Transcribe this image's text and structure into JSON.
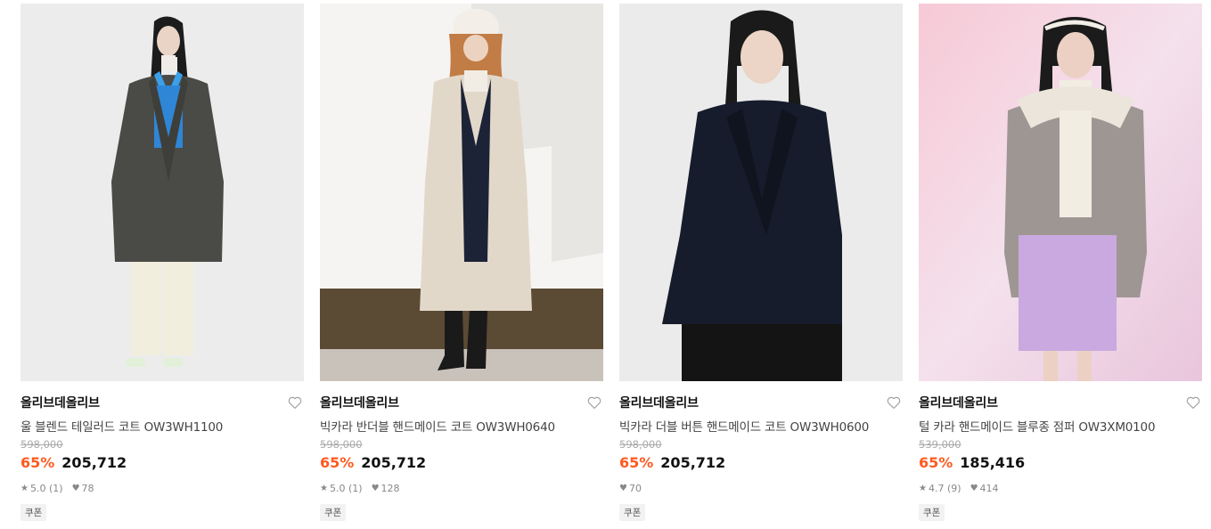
{
  "products": [
    {
      "brand": "올리브데올리브",
      "name": "울 블렌드 테일러드 코트 OW3WH1100",
      "original_price": "598,000",
      "discount": "65%",
      "price": "205,712",
      "rating": "5.0",
      "review_count": "(1)",
      "likes": "78",
      "coupon": "쿠폰"
    },
    {
      "brand": "올리브데올리브",
      "name": "빅카라 반더블 핸드메이드 코트 OW3WH0640",
      "original_price": "598,000",
      "discount": "65%",
      "price": "205,712",
      "rating": "5.0",
      "review_count": "(1)",
      "likes": "128",
      "coupon": "쿠폰"
    },
    {
      "brand": "올리브데올리브",
      "name": "빅카라 더블 버튼 핸드메이드 코트 OW3WH0600",
      "original_price": "598,000",
      "discount": "65%",
      "price": "205,712",
      "likes": "70",
      "coupon": "쿠폰"
    },
    {
      "brand": "올리브데올리브",
      "name": "털 카라 핸드메이드 블루종 점퍼 OW3XM0100",
      "original_price": "539,000",
      "discount": "65%",
      "price": "185,416",
      "rating": "4.7",
      "review_count": "(9)",
      "likes": "414",
      "coupon": "쿠폰"
    }
  ],
  "colors": {
    "discount": "#ff5a1f",
    "price": "#111111",
    "muted": "#888888",
    "coupon_bg": "#f2f2f2"
  },
  "icons": [
    "heart-outline-icon",
    "star-icon",
    "heart-filled-icon"
  ]
}
